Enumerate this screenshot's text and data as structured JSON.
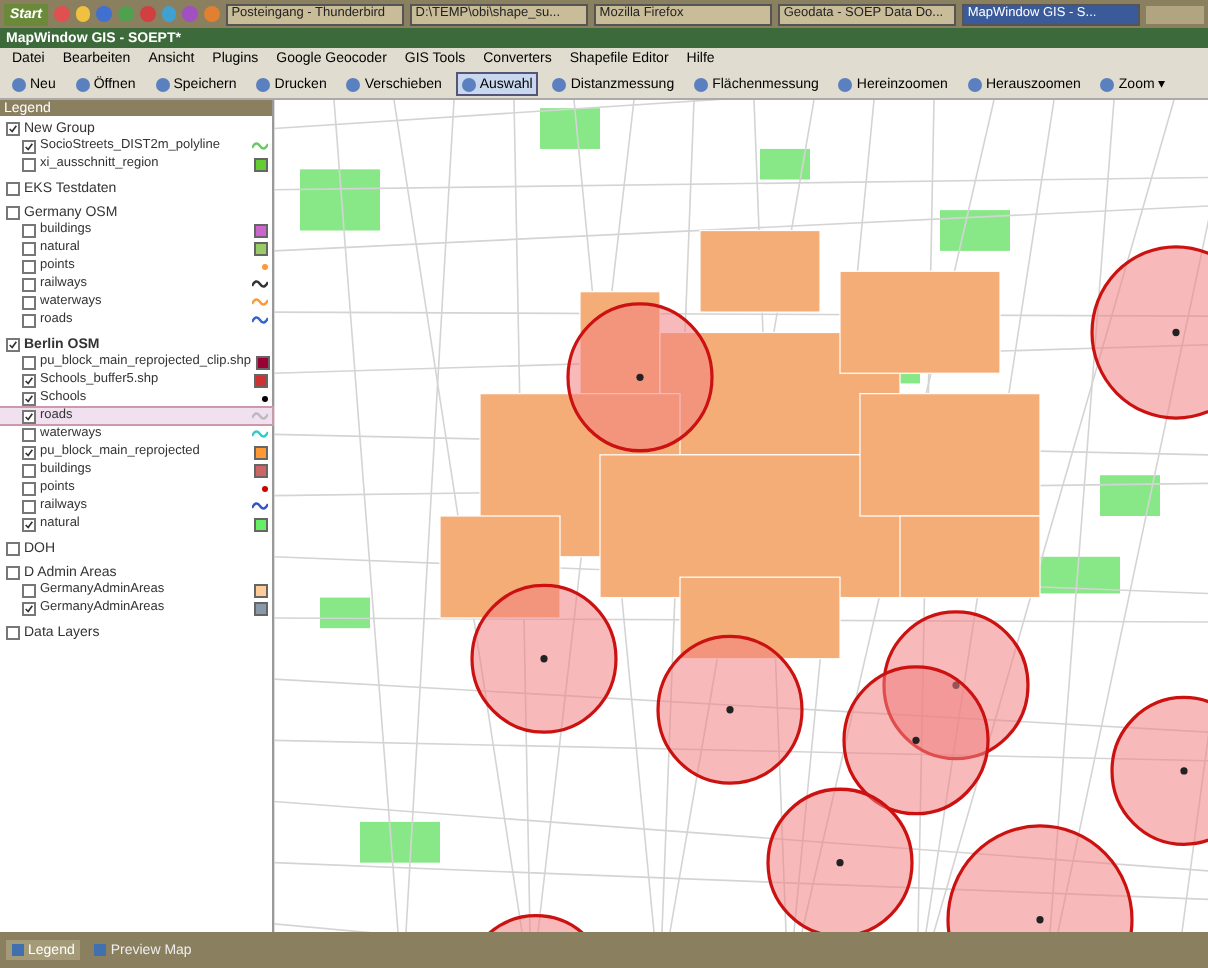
{
  "taskbar": {
    "start": "Start",
    "tasks": [
      {
        "label": "Posteingang - Thunderbird",
        "selected": false
      },
      {
        "label": "D:\\TEMP\\obi\\shape_su...",
        "selected": false
      },
      {
        "label": "Mozilla Firefox",
        "selected": false
      },
      {
        "label": "Geodata - SOEP Data Do...",
        "selected": false
      },
      {
        "label": "MapWindow GIS - S...",
        "selected": true
      }
    ]
  },
  "window": {
    "title": "MapWindow GIS - SOEPT*"
  },
  "menu": [
    "Datei",
    "Bearbeiten",
    "Ansicht",
    "Plugins",
    "Google Geocoder",
    "GIS Tools",
    "Converters",
    "Shapefile Editor",
    "Hilfe"
  ],
  "toolbar": [
    {
      "label": "Neu",
      "selected": false
    },
    {
      "label": "Öffnen",
      "selected": false
    },
    {
      "label": "Speichern",
      "selected": false
    },
    {
      "label": "Drucken",
      "selected": false
    },
    {
      "label": "Verschieben",
      "selected": false
    },
    {
      "label": "Auswahl",
      "selected": true
    },
    {
      "label": "Distanzmessung",
      "selected": false
    },
    {
      "label": "Flächenmessung",
      "selected": false
    },
    {
      "label": "Hereinzoomen",
      "selected": false
    },
    {
      "label": "Herauszoomen",
      "selected": false
    },
    {
      "label": "Zoom ▾",
      "selected": false
    }
  ],
  "legend": {
    "title": "Legend",
    "groups": [
      {
        "name": "New Group",
        "checked": true,
        "bold": false,
        "children": [
          {
            "name": "SocioStreets_DIST2m_polyline",
            "checked": true,
            "selected": false,
            "kind": "line",
            "color": "#66cc66"
          },
          {
            "name": "xi_ausschnitt_region",
            "checked": false,
            "selected": false,
            "kind": "fill",
            "color": "#66cc33"
          }
        ]
      },
      {
        "name": "EKS Testdaten",
        "checked": false,
        "bold": false
      },
      {
        "name": "Germany OSM",
        "checked": false,
        "bold": false,
        "children": [
          {
            "name": "buildings",
            "checked": false,
            "selected": false,
            "kind": "fill",
            "color": "#cc66cc"
          },
          {
            "name": "natural",
            "checked": false,
            "selected": false,
            "kind": "fill",
            "color": "#99cc66"
          },
          {
            "name": "points",
            "checked": false,
            "selected": false,
            "kind": "point",
            "color": "#ff9933"
          },
          {
            "name": "railways",
            "checked": false,
            "selected": false,
            "kind": "line",
            "color": "#333333"
          },
          {
            "name": "waterways",
            "checked": false,
            "selected": false,
            "kind": "line",
            "color": "#ff9933"
          },
          {
            "name": "roads",
            "checked": false,
            "selected": false,
            "kind": "line",
            "color": "#3366cc"
          }
        ]
      },
      {
        "name": "Berlin OSM",
        "checked": true,
        "bold": true,
        "children": [
          {
            "name": "pu_block_main_reprojected_clip.shp",
            "checked": false,
            "selected": false,
            "kind": "fill",
            "color": "#990033"
          },
          {
            "name": "Schools_buffer5.shp",
            "checked": true,
            "selected": false,
            "kind": "fill",
            "color": "#cc3333"
          },
          {
            "name": "Schools",
            "checked": true,
            "selected": false,
            "kind": "point",
            "color": "#000000"
          },
          {
            "name": "roads",
            "checked": true,
            "selected": true,
            "kind": "line",
            "color": "#bbbbbb"
          },
          {
            "name": "waterways",
            "checked": false,
            "selected": false,
            "kind": "line",
            "color": "#33cccc"
          },
          {
            "name": "pu_block_main_reprojected",
            "checked": true,
            "selected": false,
            "kind": "fill",
            "color": "#ff9933"
          },
          {
            "name": "buildings",
            "checked": false,
            "selected": false,
            "kind": "fill",
            "color": "#cc6666"
          },
          {
            "name": "points",
            "checked": false,
            "selected": false,
            "kind": "point",
            "color": "#cc0000"
          },
          {
            "name": "railways",
            "checked": false,
            "selected": false,
            "kind": "line",
            "color": "#3355cc"
          },
          {
            "name": "natural",
            "checked": true,
            "selected": false,
            "kind": "fill",
            "color": "#66ee66"
          }
        ]
      },
      {
        "name": "DOH",
        "checked": false,
        "bold": false
      },
      {
        "name": "D Admin Areas",
        "checked": false,
        "bold": false,
        "children": [
          {
            "name": "GermanyAdminAreas",
            "checked": false,
            "selected": false,
            "kind": "fill",
            "color": "#ffcc99"
          },
          {
            "name": "GermanyAdminAreas",
            "checked": true,
            "selected": false,
            "kind": "fill",
            "color": "#8899aa"
          }
        ]
      },
      {
        "name": "Data Layers",
        "checked": false,
        "bold": false
      }
    ]
  },
  "bottom_tabs": [
    {
      "label": "Legend",
      "selected": true
    },
    {
      "label": "Preview Map",
      "selected": false
    }
  ]
}
